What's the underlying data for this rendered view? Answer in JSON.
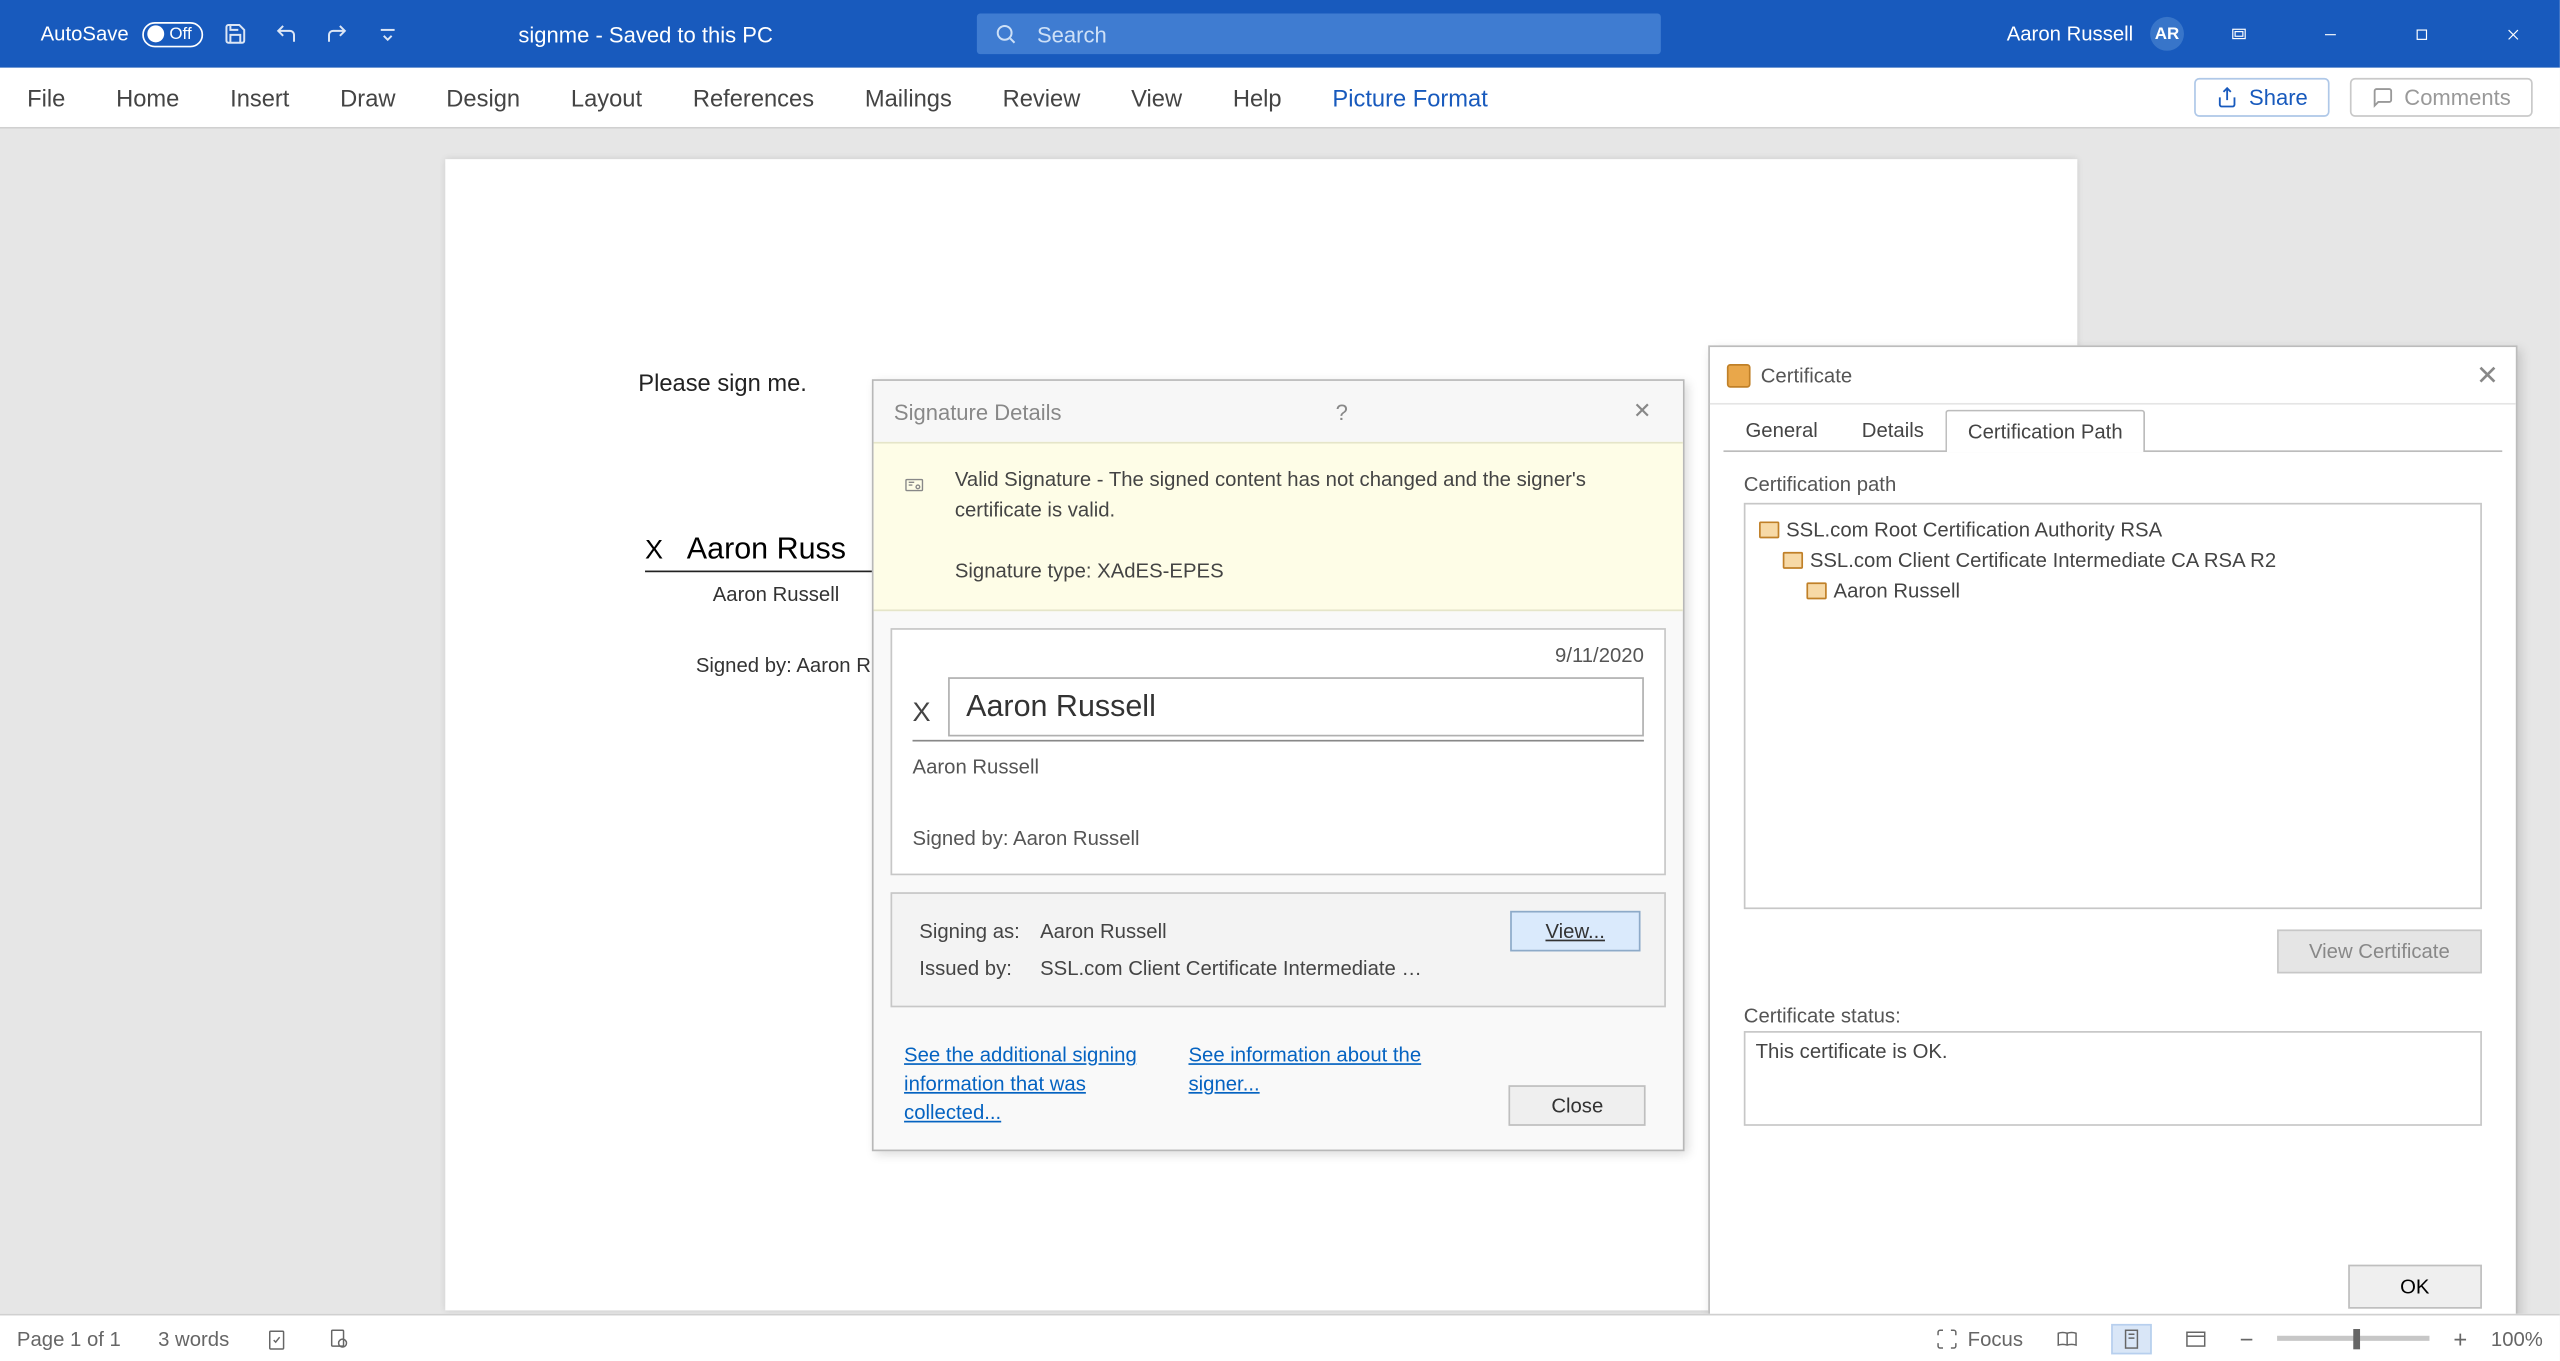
{
  "titlebar": {
    "autosave_label": "AutoSave",
    "autosave_value": "Off",
    "doc_title": "signme  -  Saved to this PC",
    "search_placeholder": "Search",
    "user_name": "Aaron Russell",
    "user_initials": "AR"
  },
  "ribbon": {
    "tabs": [
      "File",
      "Home",
      "Insert",
      "Draw",
      "Design",
      "Layout",
      "References",
      "Mailings",
      "Review",
      "View",
      "Help",
      "Picture Format"
    ],
    "share": "Share",
    "comments": "Comments"
  },
  "page": {
    "prompt": "Please sign me.",
    "signed_name": "Aaron Russ",
    "signed_under": "Aaron Russell",
    "signed_by": "Signed by: Aaron Rus"
  },
  "sig_dialog": {
    "title": "Signature Details",
    "valid_msg": "Valid Signature - The signed content has not changed and the signer's certificate is valid.",
    "sig_type": "Signature type: XAdES-EPES",
    "date": "9/11/2020",
    "name_input": "Aaron Russell",
    "under": "Aaron Russell",
    "signed_by": "Signed by: Aaron Russell",
    "signing_as_label": "Signing as:",
    "signing_as_value": "Aaron Russell",
    "issued_by_label": "Issued by:",
    "issued_by_value": "SSL.com Client Certificate Intermediate CA RS...",
    "view_btn": "View...",
    "link1": "See the additional signing information that was collected...",
    "link2": "See information about the signer...",
    "close_btn": "Close"
  },
  "cert_dialog": {
    "title": "Certificate",
    "tabs": [
      "General",
      "Details",
      "Certification Path"
    ],
    "cert_path_label": "Certification path",
    "tree": [
      "SSL.com Root Certification Authority RSA",
      "SSL.com Client Certificate Intermediate CA RSA R2",
      "Aaron Russell"
    ],
    "view_cert_btn": "View Certificate",
    "status_label": "Certificate status:",
    "status_text": "This certificate is OK.",
    "ok_btn": "OK"
  },
  "statusbar": {
    "page": "Page 1 of 1",
    "words": "3 words",
    "focus": "Focus",
    "zoom": "100%"
  }
}
